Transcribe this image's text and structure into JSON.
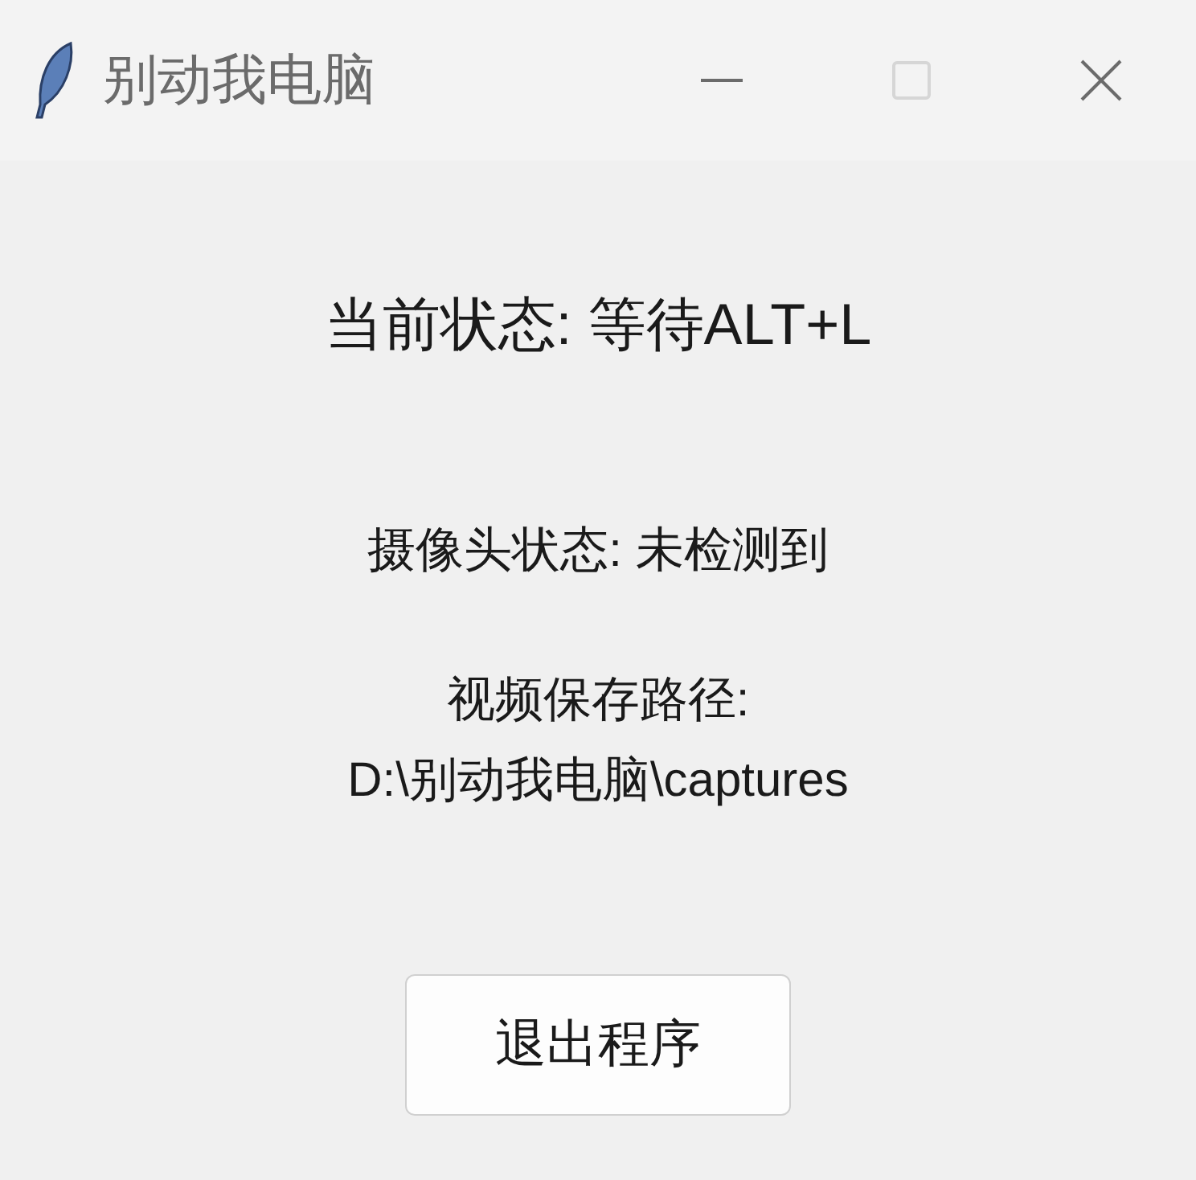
{
  "window": {
    "title": "别动我电脑",
    "controls": [
      {
        "kind": "minimize",
        "disabled": false
      },
      {
        "kind": "maximize",
        "disabled": true
      },
      {
        "kind": "close",
        "disabled": false
      }
    ]
  },
  "status": "当前状态: 等待ALT+L",
  "camera_status": "摄像头状态: 未检测到",
  "save_path": {
    "label": "视频保存路径:",
    "value": "D:\\别动我电脑\\captures"
  },
  "buttons": [
    {
      "label": "退出程序"
    }
  ]
}
